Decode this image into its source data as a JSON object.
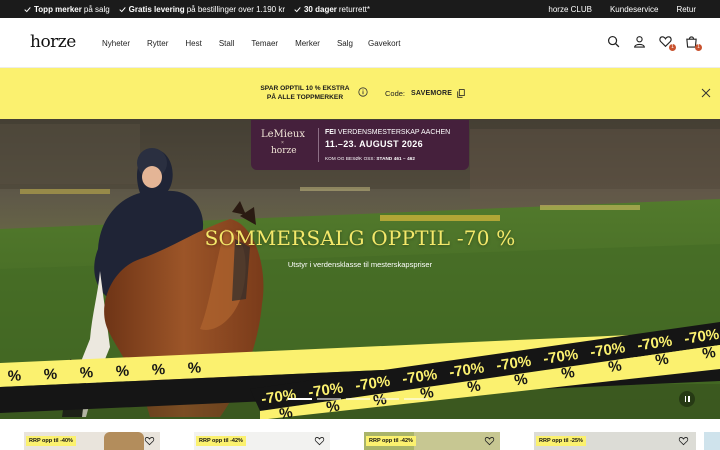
{
  "usp": [
    {
      "bold": "Topp merker",
      "text": "på salg",
      "icon": "check-icon"
    },
    {
      "bold": "Gratis levering",
      "text": "på bestillinger over 1.190 kr",
      "icon": "check-icon"
    },
    {
      "bold": "30 dager",
      "text": "returrett*",
      "icon": "check-icon"
    }
  ],
  "top_links": [
    "horze CLUB",
    "Kundeservice",
    "Retur"
  ],
  "logo": "horze",
  "nav": [
    "Nyheter",
    "Rytter",
    "Hest",
    "Stall",
    "Temaer",
    "Merker",
    "Salg",
    "Gavekort"
  ],
  "header_icons": [
    "search-icon",
    "user-icon",
    "heart-icon",
    "bag-icon"
  ],
  "badges": {
    "wishlist": "1",
    "cart": "1"
  },
  "promo": {
    "line1": "SPAR OPPTIL 10 % EKSTRA",
    "line2": "PÅ ALLE TOPPMERKER",
    "code_label": "Code:",
    "code": "SAVEMORE",
    "bg_color": "#fbf16f"
  },
  "sponsor": {
    "brand": "LeMieux",
    "x": "×",
    "partner": "horze",
    "event_bold": "FEI",
    "event": "VERDENSMESTERSKAP AACHEN",
    "dates": "11.–23. AUGUST 2026",
    "visit": "KOM OG BESØK OSS:",
    "stand": "STAND 461 – 462"
  },
  "hero": {
    "title": "SOMMERSALG OPPTIL -70 %",
    "subtitle": "Utstyr i verdensklasse til mesterskapspriser",
    "tape_label": "-70%",
    "tape_symbol": "%",
    "slides": 5,
    "active_slide": 0
  },
  "cards": [
    {
      "badge": "RRP opp til -40%"
    },
    {
      "badge": "RRP opp til -42%"
    },
    {
      "badge": "RRP opp til -42%"
    },
    {
      "badge": "RRP opp til -25%"
    }
  ]
}
